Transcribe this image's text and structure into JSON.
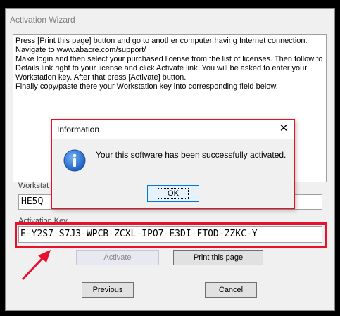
{
  "window": {
    "title": "Activation Wizard"
  },
  "instructions": {
    "lines": [
      "Press [Print this page] button and go to another computer having Internet connection.",
      "Navigate to www.abacre.com/support/",
      "Make login and then select your purchased license from the list of licenses. Then follow to",
      "Details link right to your license and click Activate link. You will be asked to enter your",
      "Workstation key. After that press [Activate] button.",
      "Finally copy/paste there your Workstation key into corresponding field below."
    ]
  },
  "workstation": {
    "label": "Workstat",
    "value": "HE5Q"
  },
  "activation": {
    "label": "Activation Key",
    "value": "E-Y2S7-S7J3-WPCB-ZCXL-IPO7-E3DI-FTOD-ZZKC-Y"
  },
  "buttons": {
    "activate": "Activate",
    "print": "Print this page",
    "previous": "Previous",
    "cancel": "Cancel"
  },
  "dialog": {
    "title": "Information",
    "close": "✕",
    "icon": "info-icon",
    "message": "Your this software has been successfully activated.",
    "ok": "OK"
  },
  "colors": {
    "highlight": "#e8112d",
    "dialog_border": "#e81123",
    "info_icon": "#1c6fd0"
  }
}
